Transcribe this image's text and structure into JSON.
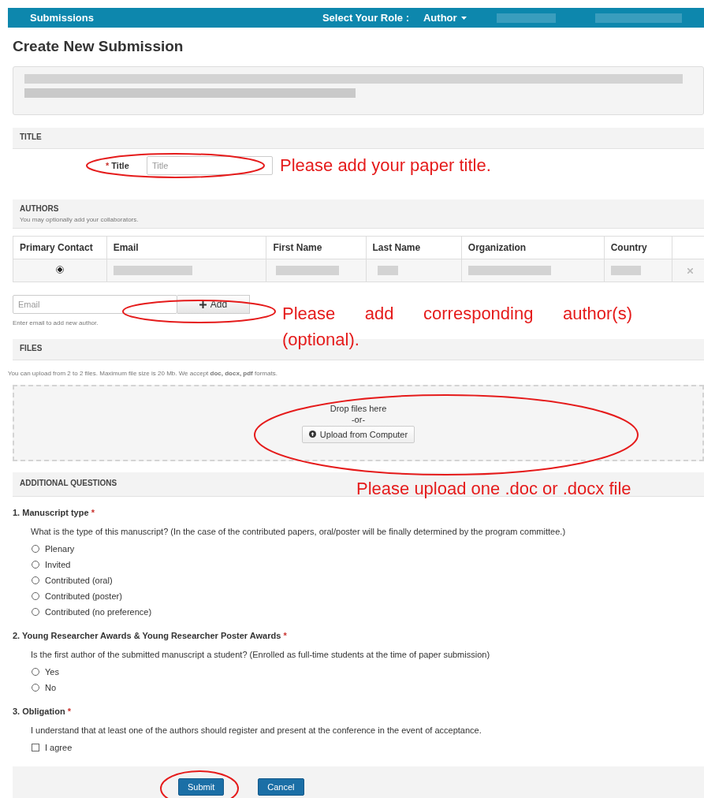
{
  "navbar": {
    "brand": "Submissions",
    "role_label": "Select Your Role :",
    "role_value": "Author"
  },
  "page_title": "Create New Submission",
  "title_section": {
    "header": "TITLE",
    "label": "Title",
    "required_mark": "*",
    "placeholder": "Title"
  },
  "authors_section": {
    "header": "AUTHORS",
    "subtitle": "You may optionally add your collaborators.",
    "columns": [
      "Primary Contact",
      "Email",
      "First Name",
      "Last Name",
      "Organization",
      "Country"
    ],
    "rows": [
      {
        "selected": true
      }
    ],
    "email_placeholder": "Email",
    "add_button": "Add",
    "helper": "Enter email to add new author."
  },
  "files_section": {
    "header": "FILES",
    "info": "You can upload from 2 to 2 files. Maximum file size is 20 Mb. We accept **doc, docx, pdf** formats.",
    "drop_text": "Drop files here",
    "or_text": "-or-",
    "upload_button": "Upload from Computer"
  },
  "questions_section": {
    "header": "ADDITIONAL QUESTIONS",
    "questions": [
      {
        "title": "1. Manuscript type",
        "required_mark": "*",
        "kind": "radio",
        "description": "What is the type of this manuscript? (In the case of the contributed papers, oral/poster will be finally determined by the program committee.)",
        "options": [
          {
            "label": "Plenary",
            "selected": false
          },
          {
            "label": "Invited",
            "selected": false
          },
          {
            "label": "Contributed (oral)",
            "selected": false
          },
          {
            "label": "Contributed (poster)",
            "selected": false
          },
          {
            "label": "Contributed (no preference)",
            "selected": false
          }
        ]
      },
      {
        "title": "2. Young Researcher Awards & Young Researcher Poster Awards",
        "required_mark": "*",
        "kind": "radio",
        "description": "Is the first author of the submitted manuscript a student? (Enrolled as full-time students at the time of paper submission)",
        "options": [
          {
            "label": "Yes",
            "selected": false
          },
          {
            "label": "No",
            "selected": false
          }
        ]
      },
      {
        "title": "3. Obligation",
        "required_mark": "*",
        "kind": "checkbox",
        "description": "I understand that at least one of the authors should register and present at the conference in the event of acceptance.",
        "options": [
          {
            "label": "I agree",
            "checked": false
          }
        ]
      }
    ]
  },
  "buttons": [
    "Submit",
    "Cancel"
  ],
  "annotations": [
    "Please add your paper title.",
    "Please add corresponding author(s) (optional).",
    "Please upload one .doc or .docx file"
  ]
}
